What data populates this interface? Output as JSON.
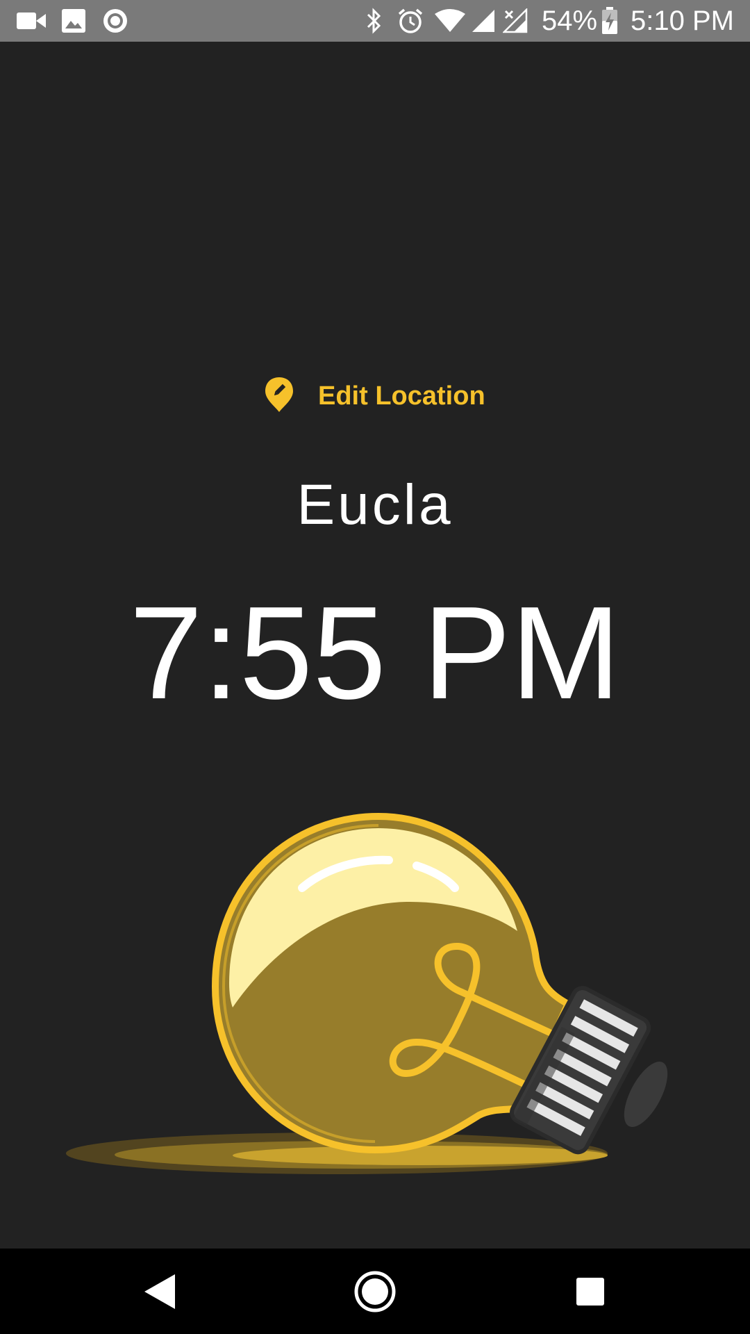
{
  "status_bar": {
    "battery_percent": "54%",
    "clock": "5:10 PM",
    "icons_left": [
      "video-camera-icon",
      "image-icon",
      "record-icon"
    ],
    "icons_right": [
      "bluetooth-icon",
      "alarm-icon",
      "wifi-icon",
      "signal-icon",
      "signal-no-data-icon",
      "battery-charging-icon"
    ]
  },
  "main": {
    "edit_location_label": "Edit Location",
    "location_name": "Eucla",
    "time": "7:55 PM",
    "illustration": "lightbulb-icon"
  },
  "nav_bar": {
    "buttons": [
      "back-button",
      "home-button",
      "recents-button"
    ]
  },
  "colors": {
    "accent": "#f6c12b",
    "background": "#222222",
    "status_bar": "#7a7a7a",
    "nav_bar": "#000000",
    "text": "#ffffff"
  }
}
